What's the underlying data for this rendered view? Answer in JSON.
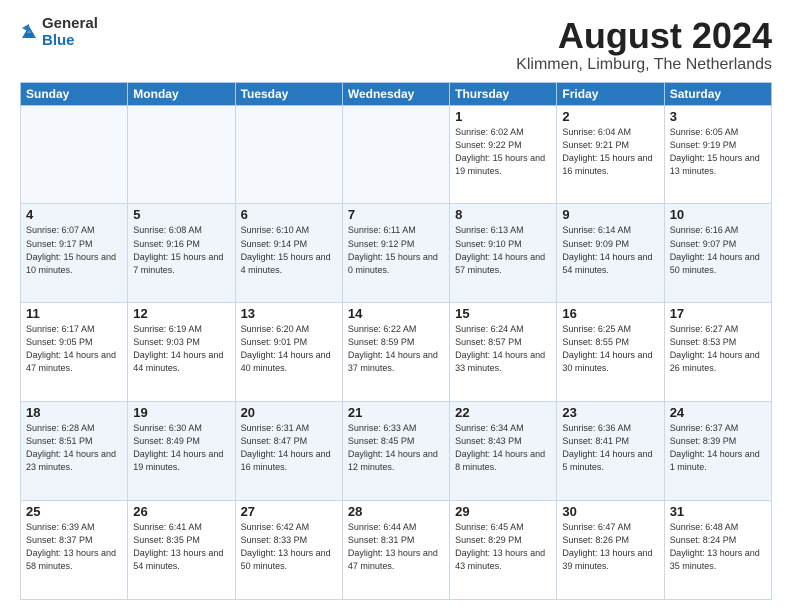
{
  "header": {
    "logo_general": "General",
    "logo_blue": "Blue",
    "title": "August 2024",
    "subtitle": "Klimmen, Limburg, The Netherlands"
  },
  "days_of_week": [
    "Sunday",
    "Monday",
    "Tuesday",
    "Wednesday",
    "Thursday",
    "Friday",
    "Saturday"
  ],
  "weeks": [
    [
      {
        "day": "",
        "empty": true
      },
      {
        "day": "",
        "empty": true
      },
      {
        "day": "",
        "empty": true
      },
      {
        "day": "",
        "empty": true
      },
      {
        "day": "1",
        "sunrise": "6:02 AM",
        "sunset": "9:22 PM",
        "daylight": "15 hours and 19 minutes."
      },
      {
        "day": "2",
        "sunrise": "6:04 AM",
        "sunset": "9:21 PM",
        "daylight": "15 hours and 16 minutes."
      },
      {
        "day": "3",
        "sunrise": "6:05 AM",
        "sunset": "9:19 PM",
        "daylight": "15 hours and 13 minutes."
      }
    ],
    [
      {
        "day": "4",
        "sunrise": "6:07 AM",
        "sunset": "9:17 PM",
        "daylight": "15 hours and 10 minutes."
      },
      {
        "day": "5",
        "sunrise": "6:08 AM",
        "sunset": "9:16 PM",
        "daylight": "15 hours and 7 minutes."
      },
      {
        "day": "6",
        "sunrise": "6:10 AM",
        "sunset": "9:14 PM",
        "daylight": "15 hours and 4 minutes."
      },
      {
        "day": "7",
        "sunrise": "6:11 AM",
        "sunset": "9:12 PM",
        "daylight": "15 hours and 0 minutes."
      },
      {
        "day": "8",
        "sunrise": "6:13 AM",
        "sunset": "9:10 PM",
        "daylight": "14 hours and 57 minutes."
      },
      {
        "day": "9",
        "sunrise": "6:14 AM",
        "sunset": "9:09 PM",
        "daylight": "14 hours and 54 minutes."
      },
      {
        "day": "10",
        "sunrise": "6:16 AM",
        "sunset": "9:07 PM",
        "daylight": "14 hours and 50 minutes."
      }
    ],
    [
      {
        "day": "11",
        "sunrise": "6:17 AM",
        "sunset": "9:05 PM",
        "daylight": "14 hours and 47 minutes."
      },
      {
        "day": "12",
        "sunrise": "6:19 AM",
        "sunset": "9:03 PM",
        "daylight": "14 hours and 44 minutes."
      },
      {
        "day": "13",
        "sunrise": "6:20 AM",
        "sunset": "9:01 PM",
        "daylight": "14 hours and 40 minutes."
      },
      {
        "day": "14",
        "sunrise": "6:22 AM",
        "sunset": "8:59 PM",
        "daylight": "14 hours and 37 minutes."
      },
      {
        "day": "15",
        "sunrise": "6:24 AM",
        "sunset": "8:57 PM",
        "daylight": "14 hours and 33 minutes."
      },
      {
        "day": "16",
        "sunrise": "6:25 AM",
        "sunset": "8:55 PM",
        "daylight": "14 hours and 30 minutes."
      },
      {
        "day": "17",
        "sunrise": "6:27 AM",
        "sunset": "8:53 PM",
        "daylight": "14 hours and 26 minutes."
      }
    ],
    [
      {
        "day": "18",
        "sunrise": "6:28 AM",
        "sunset": "8:51 PM",
        "daylight": "14 hours and 23 minutes."
      },
      {
        "day": "19",
        "sunrise": "6:30 AM",
        "sunset": "8:49 PM",
        "daylight": "14 hours and 19 minutes."
      },
      {
        "day": "20",
        "sunrise": "6:31 AM",
        "sunset": "8:47 PM",
        "daylight": "14 hours and 16 minutes."
      },
      {
        "day": "21",
        "sunrise": "6:33 AM",
        "sunset": "8:45 PM",
        "daylight": "14 hours and 12 minutes."
      },
      {
        "day": "22",
        "sunrise": "6:34 AM",
        "sunset": "8:43 PM",
        "daylight": "14 hours and 8 minutes."
      },
      {
        "day": "23",
        "sunrise": "6:36 AM",
        "sunset": "8:41 PM",
        "daylight": "14 hours and 5 minutes."
      },
      {
        "day": "24",
        "sunrise": "6:37 AM",
        "sunset": "8:39 PM",
        "daylight": "14 hours and 1 minute."
      }
    ],
    [
      {
        "day": "25",
        "sunrise": "6:39 AM",
        "sunset": "8:37 PM",
        "daylight": "13 hours and 58 minutes."
      },
      {
        "day": "26",
        "sunrise": "6:41 AM",
        "sunset": "8:35 PM",
        "daylight": "13 hours and 54 minutes."
      },
      {
        "day": "27",
        "sunrise": "6:42 AM",
        "sunset": "8:33 PM",
        "daylight": "13 hours and 50 minutes."
      },
      {
        "day": "28",
        "sunrise": "6:44 AM",
        "sunset": "8:31 PM",
        "daylight": "13 hours and 47 minutes."
      },
      {
        "day": "29",
        "sunrise": "6:45 AM",
        "sunset": "8:29 PM",
        "daylight": "13 hours and 43 minutes."
      },
      {
        "day": "30",
        "sunrise": "6:47 AM",
        "sunset": "8:26 PM",
        "daylight": "13 hours and 39 minutes."
      },
      {
        "day": "31",
        "sunrise": "6:48 AM",
        "sunset": "8:24 PM",
        "daylight": "13 hours and 35 minutes."
      }
    ]
  ],
  "labels": {
    "sunrise": "Sunrise:",
    "sunset": "Sunset:",
    "daylight": "Daylight:"
  }
}
